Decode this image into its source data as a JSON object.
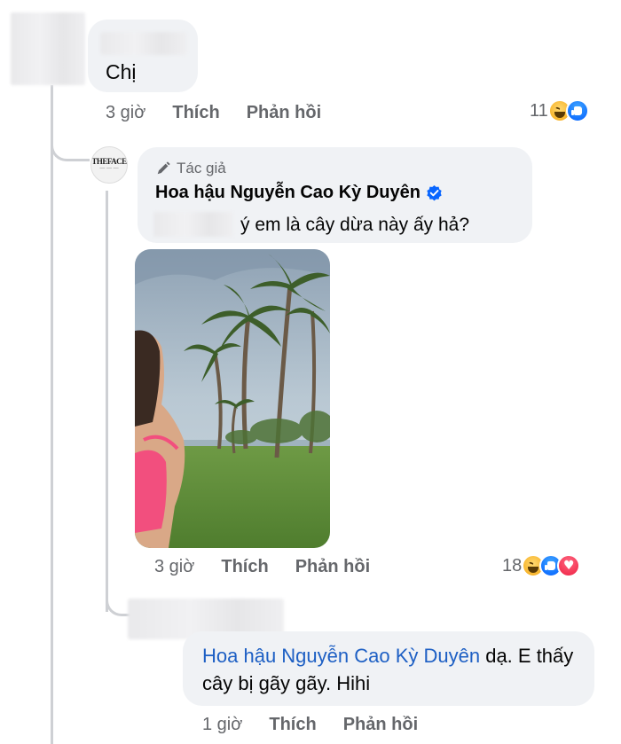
{
  "comments": [
    {
      "text": "Chị",
      "time": "3 giờ",
      "like_label": "Thích",
      "reply_label": "Phản hồi",
      "reaction_count": "11",
      "reactions": [
        "haha-icon",
        "like-icon"
      ]
    },
    {
      "badge": "Tác giả",
      "author": "Hoa hậu Nguyễn Cao Kỳ Duyên",
      "verified": true,
      "text": "ý em là cây dừa này ấy hả?",
      "time": "3 giờ",
      "like_label": "Thích",
      "reply_label": "Phản hồi",
      "reaction_count": "18",
      "reactions": [
        "haha-icon",
        "like-icon",
        "love-icon"
      ],
      "avatar_logo": "THEFACE"
    },
    {
      "mention": "Hoa hậu Nguyễn Cao Kỳ Duyên",
      "text": " dạ. E thấy cây bị gãy gãy. Hihi",
      "time": "1 giờ",
      "like_label": "Thích",
      "reply_label": "Phản hồi"
    }
  ],
  "colors": {
    "bubble": "#f0f2f5",
    "meta": "#65676b",
    "mention": "#1d5fc4",
    "verified": "#0866ff"
  }
}
